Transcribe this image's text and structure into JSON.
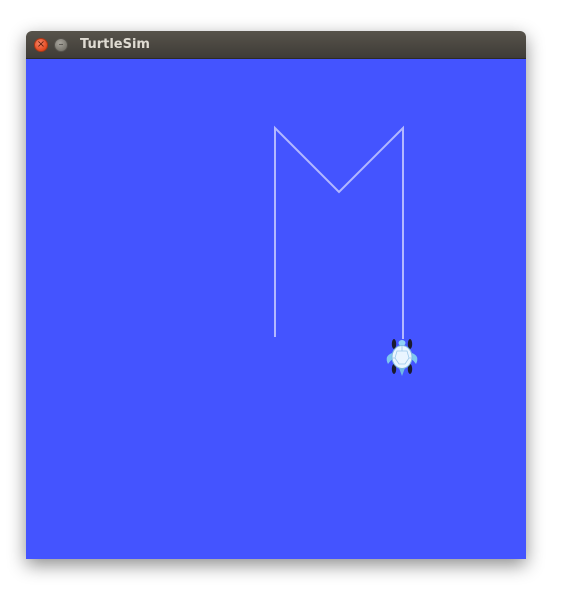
{
  "window": {
    "title": "TurtleSim"
  },
  "titlebar_buttons": {
    "close_icon": "close-icon",
    "minimize_icon": "minimize-icon"
  },
  "canvas": {
    "background_color": "#4454ff",
    "pen_color": "#b3b8ff"
  },
  "turtle": {
    "icon": "turtle-icon"
  }
}
